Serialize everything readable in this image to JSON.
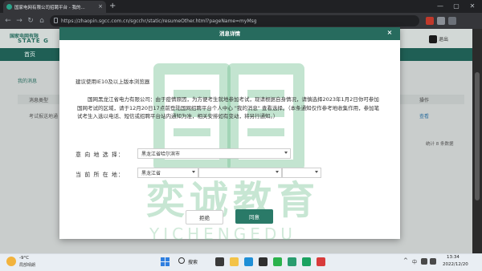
{
  "browser": {
    "tab_title": "国家电网有限公司招聘平台 - 我的...",
    "tab_close": "×",
    "new_tab": "+",
    "url": "https://zhaopin.sgcc.com.cn/sgcchr/static/resumeOther.html?pageName=myMsg",
    "minimize": "—",
    "maximize": "▢",
    "close": "✕",
    "back": "←",
    "forward": "→",
    "reload": "↻",
    "home": "⌂"
  },
  "site": {
    "logo_line1": "国家电网有限",
    "logo_line2": "STATE G",
    "nav_home": "首页",
    "logout": "退出",
    "section_title": "我的消息",
    "table_col_type": "消息类型",
    "table_col_action": "操作",
    "row_type": "考试报送地通",
    "row_action": "查看",
    "pager_text": "统计 8 条数据"
  },
  "modal": {
    "title": "消息详情",
    "close": "×",
    "browser_hint": "建议使用IE10及以上版本浏览器",
    "notice": "国网黑龙江省电力有限公司：由于疫情原因，为方便考生就地参加考试，现请根据自身情况，请慎选择2023年1月2日你可参加国网考试的区域，请于12月20日17点前登陆国网招聘平台个人中心 \"我的消息\" 查看选择。（本条通知仅作参考地收集作用，参加笔试考生入选以电话、短信或招聘平台站内通知为准，相关安排如有变动，将另行通知。）",
    "intent_label": "意 向 地 选 择：",
    "intent_value": "黑龙江省哈尔滨市",
    "current_label": "当 前 所 在 地：",
    "province_value": "黑龙江省",
    "city_value": "",
    "district_value": "",
    "reject_button": "拒绝",
    "agree_button": "同意"
  },
  "watermark": {
    "cn": "奕诚教育",
    "en": "YICHENGEDU"
  },
  "taskbar": {
    "weather_temp": "-9°C",
    "weather_desc": "局部晴朗",
    "search_label": "搜索",
    "tray_up": "^",
    "tray_lang": "中",
    "time": "13:34",
    "date": "2022/12/20"
  },
  "colors": {
    "brand_green": "#276b5e",
    "button_green": "#2a7a68",
    "watermark_green": "#7ac496"
  }
}
